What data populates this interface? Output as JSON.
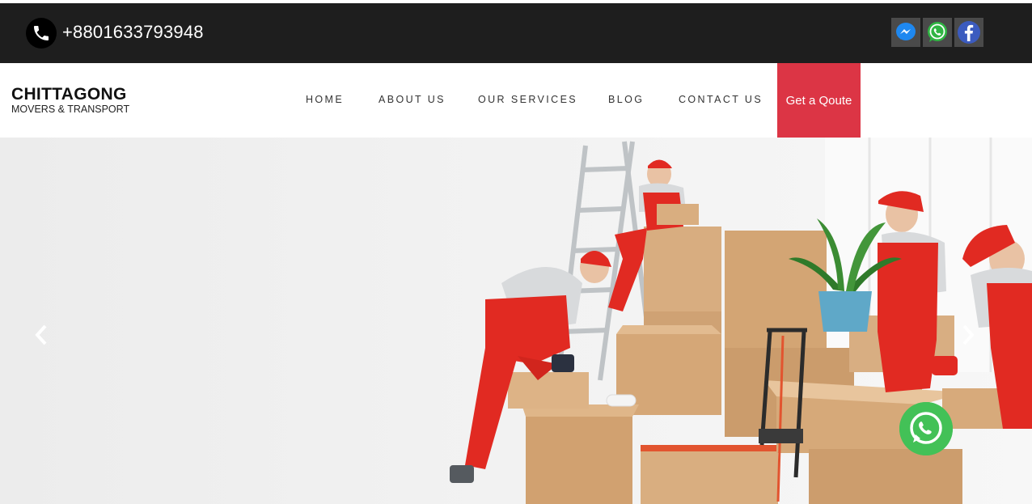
{
  "topbar": {
    "phone": "+8801633793948",
    "phone_icon": "phone-icon",
    "social": [
      "messenger-icon",
      "whatsapp-icon",
      "facebook-icon"
    ]
  },
  "brand": {
    "title": "CHITTAGONG",
    "subtitle": "MOVERS & TRANSPORT"
  },
  "nav": {
    "items": [
      "HOME",
      "ABOUT US",
      "OUR SERVICES",
      "BLOG",
      "CONTACT US"
    ],
    "quote_button": "Get a Qoute"
  },
  "hero": {
    "prev_icon": "chevron-left-icon",
    "next_icon": "chevron-right-icon",
    "floating_icon": "whatsapp-icon"
  },
  "colors": {
    "topbar_bg": "#1e1e1e",
    "accent": "#dc3545",
    "whatsapp_green": "#43c157",
    "uniform_red": "#e12a22",
    "box_brown": "#d3a574"
  }
}
